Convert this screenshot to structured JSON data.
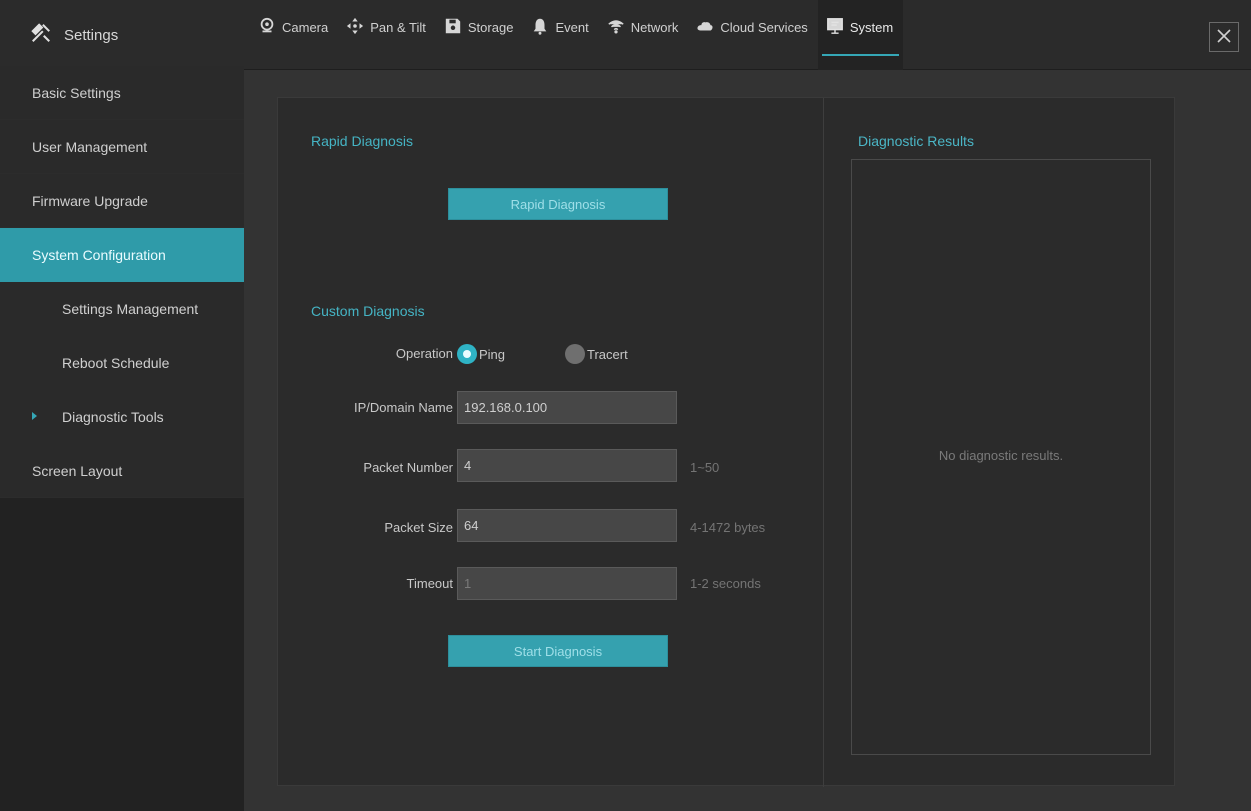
{
  "header": {
    "title": "Settings",
    "tabs": [
      {
        "label": "Camera",
        "icon": "camera-icon"
      },
      {
        "label": "Pan & Tilt",
        "icon": "pan-tilt-icon"
      },
      {
        "label": "Storage",
        "icon": "storage-icon"
      },
      {
        "label": "Event",
        "icon": "bell-icon"
      },
      {
        "label": "Network",
        "icon": "wifi-icon"
      },
      {
        "label": "Cloud Services",
        "icon": "cloud-icon"
      },
      {
        "label": "System",
        "icon": "monitor-icon",
        "active": true
      }
    ]
  },
  "sidebar": {
    "items": [
      {
        "label": "Basic Settings"
      },
      {
        "label": "User Management"
      },
      {
        "label": "Firmware Upgrade"
      },
      {
        "label": "System Configuration",
        "active": true
      },
      {
        "label": "Settings Management"
      },
      {
        "label": "Reboot Schedule"
      },
      {
        "label": "Diagnostic Tools",
        "selected": true
      },
      {
        "label": "Screen Layout"
      }
    ]
  },
  "main": {
    "rapid": {
      "title": "Rapid Diagnosis",
      "button": "Rapid Diagnosis"
    },
    "custom": {
      "title": "Custom Diagnosis",
      "operation_label": "Operation",
      "ping_label": "Ping",
      "tracert_label": "Tracert",
      "ip_label": "IP/Domain Name",
      "ip_value": "192.168.0.100",
      "packet_number_label": "Packet Number",
      "packet_number_value": "4",
      "packet_number_hint": "1~50",
      "packet_size_label": "Packet Size",
      "packet_size_value": "64",
      "packet_size_hint": "4-1472 bytes",
      "timeout_label": "Timeout",
      "timeout_value": "1",
      "timeout_hint": "1-2 seconds",
      "start_button": "Start Diagnosis"
    },
    "results": {
      "title": "Diagnostic Results",
      "empty": "No diagnostic results."
    }
  },
  "colors": {
    "accent": "#35a1af",
    "background": "#333333",
    "sidebar": "#2a2a2a"
  }
}
